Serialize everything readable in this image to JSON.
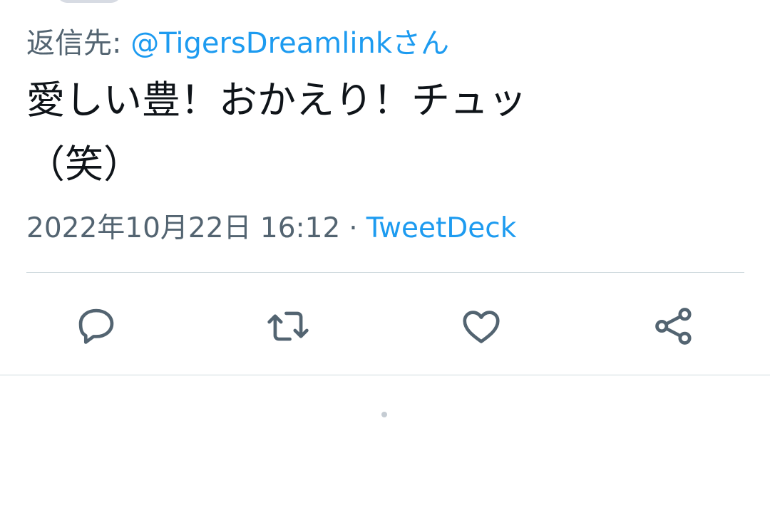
{
  "reply": {
    "prefix": "返信先: ",
    "handle": "@TigersDreamlink",
    "suffix": "さん"
  },
  "tweet": {
    "text_line1": "愛しい豊！おかえり！チュッ",
    "text_line2": "（笑）"
  },
  "meta": {
    "timestamp": "2022年10月22日 16:12",
    "separator": "·",
    "source": "TweetDeck"
  },
  "actions": {
    "reply_icon": "speech-bubble",
    "retweet_icon": "retweet-arrows",
    "like_icon": "heart",
    "share_icon": "share-nodes"
  },
  "colors": {
    "text": "#0f1419",
    "secondary": "#536471",
    "link": "#1d9bf0",
    "divider": "#cfd9de"
  }
}
